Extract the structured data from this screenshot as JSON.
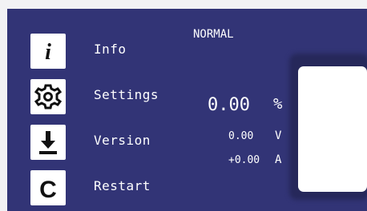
{
  "menu": {
    "items": [
      {
        "label": "Info",
        "icon": "info-icon"
      },
      {
        "label": "Settings",
        "icon": "gear-icon"
      },
      {
        "label": "Version",
        "icon": "download-icon"
      },
      {
        "label": "Restart",
        "icon": "restart-icon"
      }
    ]
  },
  "status": {
    "mode": "NORMAL",
    "percent_value": "0.00",
    "percent_unit": "%",
    "voltage_value": "0.00",
    "voltage_unit": "V",
    "current_value": "+0.00",
    "current_unit": "A"
  },
  "colors": {
    "background": "#323476",
    "foreground": "#ffffff"
  }
}
